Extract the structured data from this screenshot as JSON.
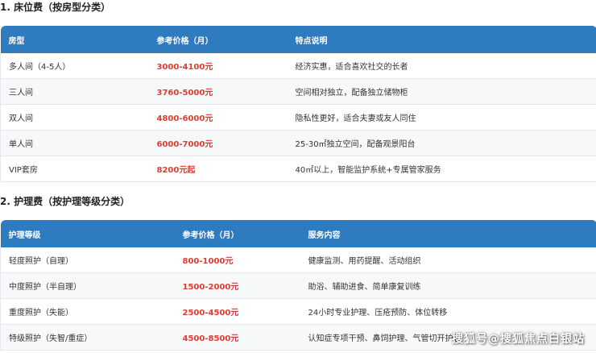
{
  "section1": {
    "title": "1. 床位费（按房型分类）",
    "headers": [
      "房型",
      "参考价格（月）",
      "特点说明"
    ],
    "rows": [
      {
        "type": "多人间（4-5人）",
        "price": "3000-4100元",
        "desc": "经济实惠，适合喜欢社交的长者"
      },
      {
        "type": "三人间",
        "price": "3760-5000元",
        "desc": "空间相对独立，配备独立储物柜"
      },
      {
        "type": "双人间",
        "price": "4800-6000元",
        "desc": "隐私性更好，适合夫妻或友人同住"
      },
      {
        "type": "单人间",
        "price": "6000-7000元",
        "desc": "25-30㎡独立空间，配备观景阳台"
      },
      {
        "type": "VIP套房",
        "price": "8200元起",
        "desc": "40㎡以上，智能监护系统+专属管家服务"
      }
    ]
  },
  "section2": {
    "title": "2. 护理费（按护理等级分类）",
    "headers": [
      "护理等级",
      "参考价格（月）",
      "服务内容"
    ],
    "rows": [
      {
        "level": "轻度照护（自理）",
        "price": "800-1000元",
        "desc": "健康监测、用药提醒、活动组织"
      },
      {
        "level": "中度照护（半自理）",
        "price": "1500-2000元",
        "desc": "助浴、辅助进食、简单康复训练"
      },
      {
        "level": "重度照护（失能）",
        "price": "2500-4500元",
        "desc": "24小时专业护理、压疮预防、体位转移"
      },
      {
        "level": "特级照护（失智/重症）",
        "price": "4500-8500元",
        "desc": "认知症专项干预、鼻饲护理、气管切开护理"
      }
    ]
  },
  "watermark": "搜狐号@搜狐焦点白银站",
  "colors": {
    "header_bg": "#2f7bc0",
    "price": "#e03b30",
    "row_alt": "#f7f8fa"
  }
}
